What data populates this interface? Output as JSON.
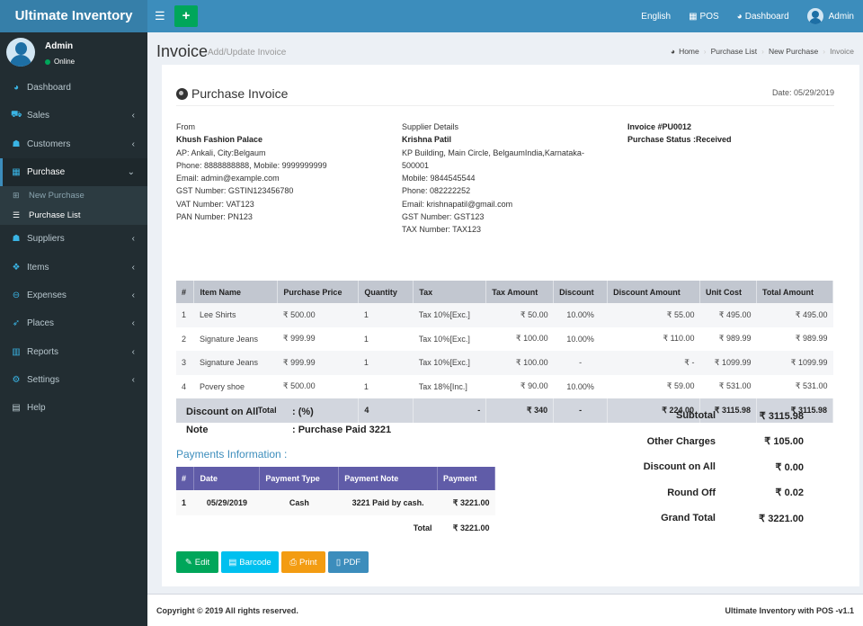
{
  "app": {
    "title": "Ultimate Inventory"
  },
  "topbar": {
    "language": "English",
    "pos": "POS",
    "dashboard": "Dashboard",
    "user": "Admin",
    "colors": {
      "header": "#3c8dbc",
      "brand": "#367fa9",
      "add": "#00a65a"
    }
  },
  "sidebar": {
    "user": {
      "name": "Admin",
      "status": "Online"
    },
    "items": [
      {
        "label": "Dashboard",
        "icon": "dashboard-icon"
      },
      {
        "label": "Sales",
        "icon": "cart-icon"
      },
      {
        "label": "Customers",
        "icon": "users-icon"
      },
      {
        "label": "Purchase",
        "icon": "grid-icon"
      },
      {
        "label": "Suppliers",
        "icon": "user-plus-icon"
      },
      {
        "label": "Items",
        "icon": "cubes-icon"
      },
      {
        "label": "Expenses",
        "icon": "minus-circle-icon"
      },
      {
        "label": "Places",
        "icon": "rocket-icon"
      },
      {
        "label": "Reports",
        "icon": "bar-chart-icon"
      },
      {
        "label": "Settings",
        "icon": "cogs-icon"
      },
      {
        "label": "Help",
        "icon": "book-icon"
      }
    ],
    "submenu": [
      {
        "label": "New Purchase",
        "icon": "plus-square-icon"
      },
      {
        "label": "Purchase List",
        "icon": "list-icon"
      }
    ]
  },
  "page": {
    "title": "Invoice",
    "subtitle": "Add/Update Invoice",
    "breadcrumb": [
      "Home",
      "Purchase List",
      "New Purchase",
      "Invoice"
    ]
  },
  "invoice": {
    "title": "Purchase Invoice",
    "date": "Date: 05/29/2019",
    "from": {
      "label": "From",
      "name": "Khush Fashion Palace",
      "lines": [
        "AP: Ankali, City:Belgaum",
        "Phone: 8888888888, Mobile: 9999999999",
        "Email: admin@example.com",
        "GST Number: GSTIN123456780",
        "VAT Number: VAT123",
        "PAN Number: PN123"
      ]
    },
    "supplier": {
      "label": "Supplier Details",
      "name": "Krishna Patil",
      "lines": [
        "KP Building, Main Circle, BelgaumIndia,Karnataka-",
        "500001",
        "Mobile: 9844545544",
        "Phone: 082222252",
        "Email: krishnapatil@gmail.com",
        "GST Number: GST123",
        "TAX Number: TAX123"
      ]
    },
    "number": "Invoice #PU0012",
    "status": "Purchase Status :Received"
  },
  "items_table": {
    "headers": [
      "#",
      "Item Name",
      "Purchase Price",
      "Quantity",
      "Tax",
      "Tax Amount",
      "Discount",
      "Discount Amount",
      "Unit Cost",
      "Total Amount"
    ],
    "rows": [
      [
        "1",
        "Lee Shirts",
        "₹ 500.00",
        "1",
        "Tax 10%[Exc.]",
        "₹ 50.00",
        "10.00%",
        "₹ 55.00",
        "₹ 495.00",
        "₹ 495.00"
      ],
      [
        "2",
        "Signature Jeans",
        "₹ 999.99",
        "1",
        "Tax 10%[Exc.]",
        "₹ 100.00",
        "10.00%",
        "₹ 110.00",
        "₹ 989.99",
        "₹ 989.99"
      ],
      [
        "3",
        "Signature Jeans",
        "₹ 999.99",
        "1",
        "Tax 10%[Exc.]",
        "₹ 100.00",
        "-",
        "₹ -",
        "₹ 1099.99",
        "₹ 1099.99"
      ],
      [
        "4",
        "Povery shoe",
        "₹ 500.00",
        "1",
        "Tax 18%[Inc.]",
        "₹ 90.00",
        "10.00%",
        "₹ 59.00",
        "₹ 531.00",
        "₹ 531.00"
      ]
    ],
    "total": {
      "label": "Total",
      "quantity": "4",
      "tax": "-",
      "tax_amount": "₹ 340",
      "discount": "-",
      "discount_amount": "₹ 224.00",
      "unit_cost": "₹ 3115.98",
      "total_amount": "₹ 3115.98"
    }
  },
  "notes": {
    "discount_label": "Discount on All",
    "discount_value": ": (%)",
    "note_label": "Note",
    "note_value": ": Purchase Paid 3221"
  },
  "payments": {
    "title": "Payments Information :",
    "headers": [
      "#",
      "Date",
      "Payment Type",
      "Payment Note",
      "Payment"
    ],
    "rows": [
      [
        "1",
        "05/29/2019",
        "Cash",
        "3221 Paid by cash.",
        "₹ 3221.00"
      ]
    ],
    "total_label": "Total",
    "total_value": "₹ 3221.00"
  },
  "summary": [
    {
      "label": "Subtotal",
      "value": "₹ 3115.98"
    },
    {
      "label": "Other Charges",
      "value": "₹ 105.00"
    },
    {
      "label": "Discount on All",
      "value": "₹ 0.00"
    },
    {
      "label": "Round Off",
      "value": "₹ 0.02"
    },
    {
      "label": "Grand Total",
      "value": "₹ 3221.00"
    }
  ],
  "actions": [
    {
      "label": "Edit",
      "color": "#00a65a"
    },
    {
      "label": "Barcode",
      "color": "#00c0ef"
    },
    {
      "label": "Print",
      "color": "#f39c12"
    },
    {
      "label": "PDF",
      "color": "#3c8dbc"
    }
  ],
  "footer": {
    "copyright": "Copyright © 2019 All rights reserved.",
    "version": "Ultimate Inventory with POS -v1.1"
  }
}
